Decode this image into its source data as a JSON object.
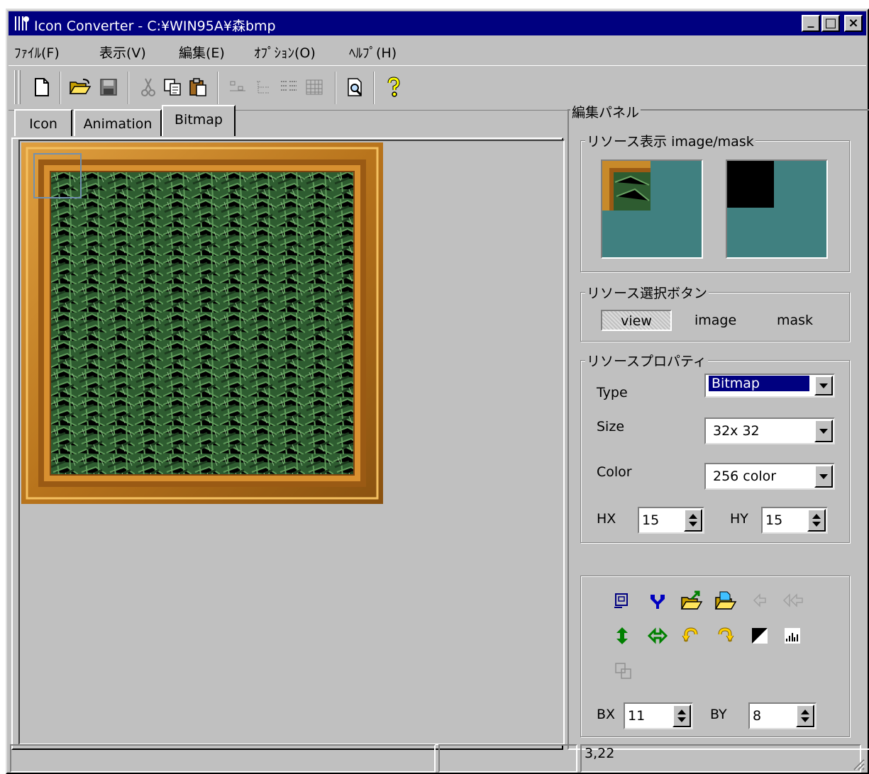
{
  "window": {
    "title": "Icon Converter - C:¥WIN95A¥森bmp",
    "controls": {
      "minimize": "_",
      "maximize": "□",
      "close": "×"
    }
  },
  "menu": [
    {
      "label": "ﾌｧｲﾙ(F)"
    },
    {
      "label": "表示(V)"
    },
    {
      "label": "編集(E)"
    },
    {
      "label": "ｵﾌﾟｼｮﾝ(O)"
    },
    {
      "label": "ﾍﾙﾌﾟ(H)"
    }
  ],
  "toolbar": {
    "icons": [
      "new-file-icon",
      "open-folder-icon",
      "save-icon",
      "cut-icon",
      "copy-icon",
      "paste-icon",
      "align-icon",
      "tree-icon",
      "list-icon",
      "grid-icon",
      "preview-icon",
      "help-icon"
    ]
  },
  "tabs": [
    {
      "label": "Icon"
    },
    {
      "label": "Animation"
    },
    {
      "label": "Bitmap",
      "active": true
    }
  ],
  "panel": {
    "title": "編集パネル",
    "resource_view": {
      "label": "リソース表示 image/mask",
      "colors": {
        "teal": "#408080",
        "frame": "#c88a2a",
        "mask": "#000000"
      }
    },
    "resource_buttons": {
      "label": "リソース選択ボタン",
      "view": "view",
      "image": "image",
      "mask": "mask"
    },
    "properties": {
      "label": "リソースプロパティ",
      "type_label": "Type",
      "type_value": "Bitmap",
      "size_label": "Size",
      "size_value": "32x 32",
      "color_label": "Color",
      "color_value": "256 color",
      "hx_label": "HX",
      "hx_value": "15",
      "hy_label": "HY",
      "hy_value": "15"
    },
    "tools": {
      "bx_label": "BX",
      "bx_value": "11",
      "by_label": "BY",
      "by_value": "8"
    }
  },
  "statusbar": {
    "coords": "3,22"
  },
  "colors": {
    "face": "#c0c0c0",
    "title_bar": "#000080",
    "selection": "#000080"
  }
}
